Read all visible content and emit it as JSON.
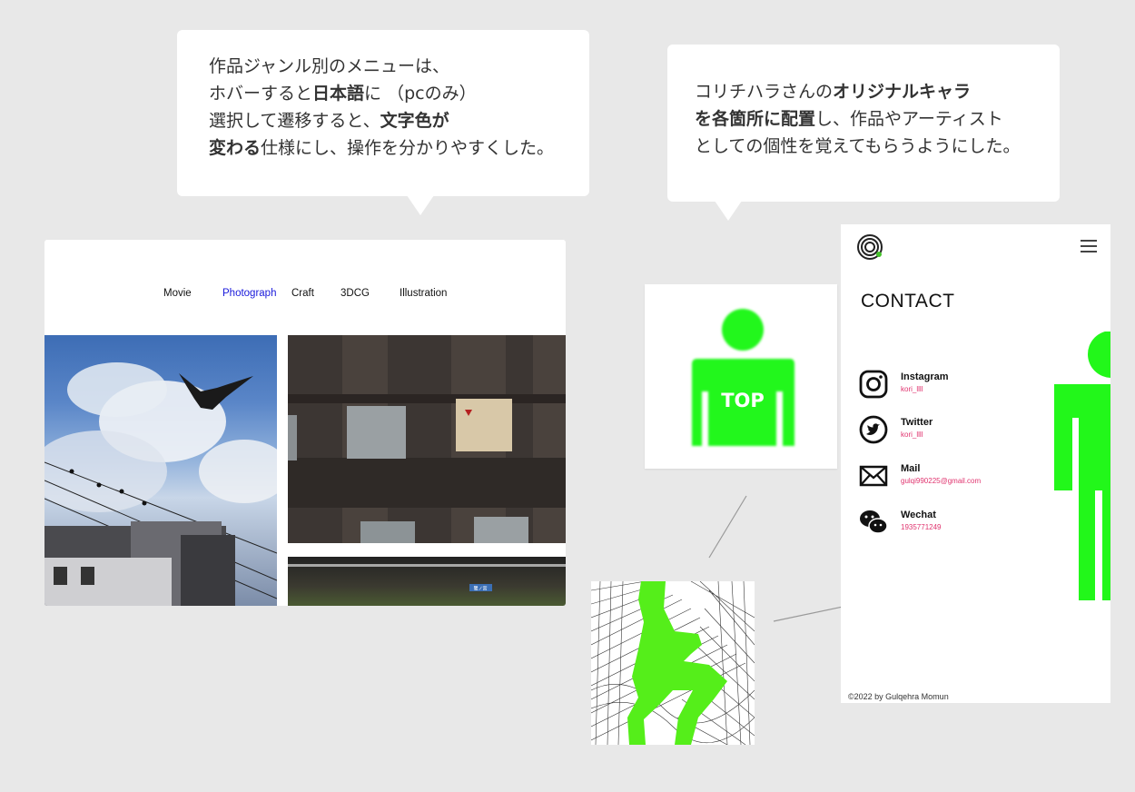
{
  "callout_left": {
    "line1": "作品ジャンル別のメニューは、",
    "line2_pre": "ホバーすると",
    "line2_bold": "日本語",
    "line2_post": "に （pcのみ）",
    "line3_pre": "選択して遷移すると、",
    "line3_bold": "文字色が",
    "line4_bold": "変わる",
    "line4_post": "仕様にし、操作を分かりやすくした。"
  },
  "callout_right": {
    "line1_pre": "コリチハラさんの",
    "line1_bold": "オリジナルキャラ",
    "line2_bold": "を各箇所に配置",
    "line2_post": "し、作品やアーティスト",
    "line3": "としての個性を覚えてもらうようにした。"
  },
  "gallery": {
    "nav": [
      "Movie",
      "Photograph",
      "Craft",
      "3DCG",
      "Illustration"
    ],
    "active": "Photograph",
    "sign_text": "鷺ノ宮"
  },
  "top_button": {
    "label": "TOP"
  },
  "contact": {
    "title": "CONTACT",
    "items": [
      {
        "name": "Instagram",
        "value": "kori_llll",
        "icon": "instagram-icon"
      },
      {
        "name": "Twitter",
        "value": "kori_llll",
        "icon": "twitter-icon"
      },
      {
        "name": "Mail",
        "value": "gulqi990225@gmail.com",
        "icon": "mail-icon"
      },
      {
        "name": "Wechat",
        "value": "1935771249",
        "icon": "wechat-icon"
      }
    ],
    "copyright": "©2022 by Gulqehra Momun"
  },
  "colors": {
    "background": "#e8e8e8",
    "character_green": "#22f71a",
    "active_nav": "#1a1adb",
    "contact_value": "#e0336e"
  }
}
